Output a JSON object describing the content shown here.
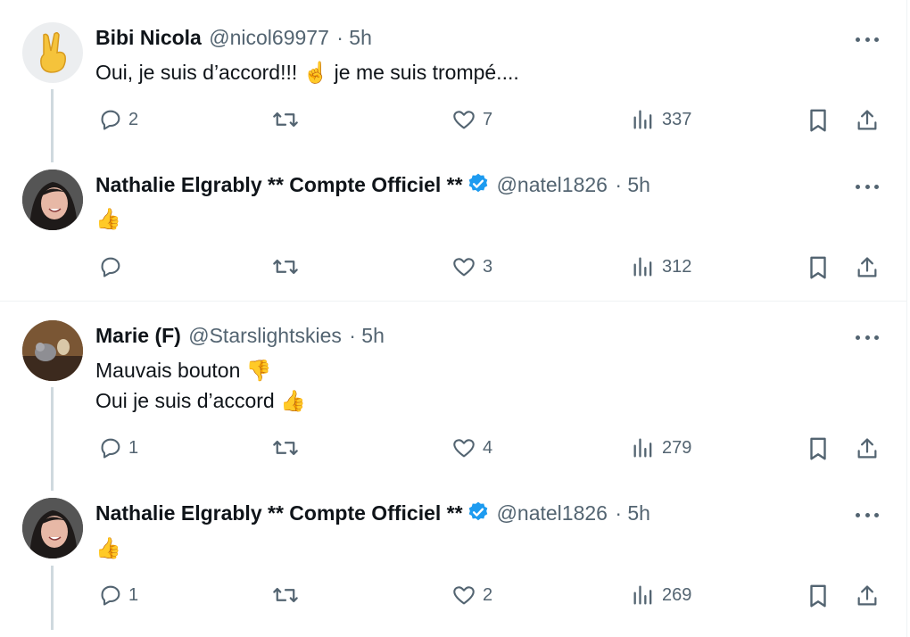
{
  "tweets": [
    {
      "name": "Bibi Nicola",
      "handle": "@nicol69977",
      "time": "· 5h",
      "verified": false,
      "avatar": "victory-hand-avatar",
      "lines": [
        "Oui, je suis d’accord!!! ☝️ je me suis trompé...."
      ],
      "replies": "2",
      "retweets": "",
      "likes": "7",
      "views": "337"
    },
    {
      "name": "Nathalie Elgrably ** Compte Officiel **",
      "handle": "@natel1826",
      "time": "· 5h",
      "verified": true,
      "avatar": "nathalie-photo-avatar",
      "lines": [
        "👍"
      ],
      "replies": "",
      "retweets": "",
      "likes": "3",
      "views": "312"
    },
    {
      "name": "Marie (F)",
      "handle": "@Starslightskies",
      "time": "· 5h",
      "verified": false,
      "avatar": "marie-photo-avatar",
      "lines": [
        "Mauvais bouton 👎",
        "Oui je suis d’accord 👍"
      ],
      "replies": "1",
      "retweets": "",
      "likes": "4",
      "views": "279"
    },
    {
      "name": "Nathalie Elgrably ** Compte Officiel **",
      "handle": "@natel1826",
      "time": "· 5h",
      "verified": true,
      "avatar": "nathalie-photo-avatar",
      "lines": [
        "👍"
      ],
      "replies": "1",
      "retweets": "",
      "likes": "2",
      "views": "269"
    }
  ],
  "colors": {
    "verified": "#1d9bf0",
    "muted": "#536471",
    "thread": "#cfd9de"
  },
  "icons": [
    "reply-icon",
    "retweet-icon",
    "like-icon",
    "views-icon",
    "bookmark-icon",
    "share-icon",
    "more-icon",
    "verified-badge-icon"
  ]
}
